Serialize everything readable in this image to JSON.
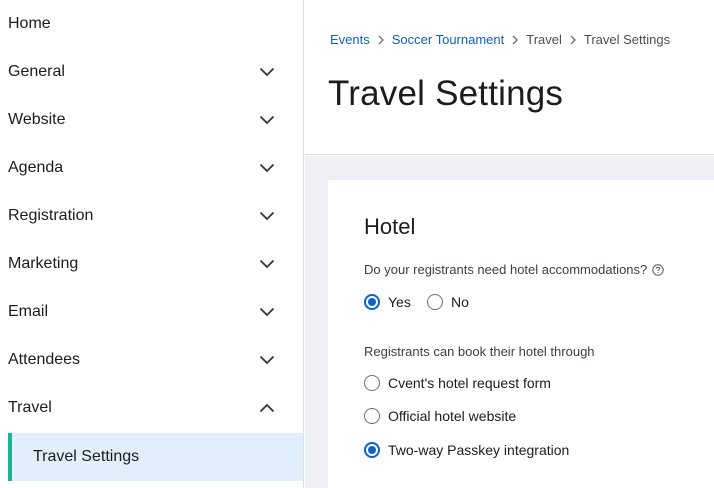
{
  "sidebar": {
    "items": [
      {
        "label": "Home"
      },
      {
        "label": "General"
      },
      {
        "label": "Website"
      },
      {
        "label": "Agenda"
      },
      {
        "label": "Registration"
      },
      {
        "label": "Marketing"
      },
      {
        "label": "Email"
      },
      {
        "label": "Attendees"
      },
      {
        "label": "Travel"
      }
    ],
    "sub_item": {
      "label": "Travel Settings"
    }
  },
  "header": {
    "breadcrumb": [
      "Events",
      "Soccer Tournament",
      "Travel",
      "Travel Settings"
    ],
    "title": "Travel Settings"
  },
  "hotel": {
    "title": "Hotel",
    "question": "Do your registrants need hotel accommodations?",
    "yes_label": "Yes",
    "no_label": "No",
    "selected_need": "Yes",
    "booking_label": "Registrants can book their hotel through",
    "booking_options": [
      "Cvent's hotel request form",
      "Official hotel website",
      "Two-way Passkey integration"
    ],
    "selected_booking": "Two-way Passkey integration"
  },
  "colors": {
    "accent": "#0b62c7",
    "active_marker": "#1bb596",
    "active_bg": "#e3eefb"
  }
}
